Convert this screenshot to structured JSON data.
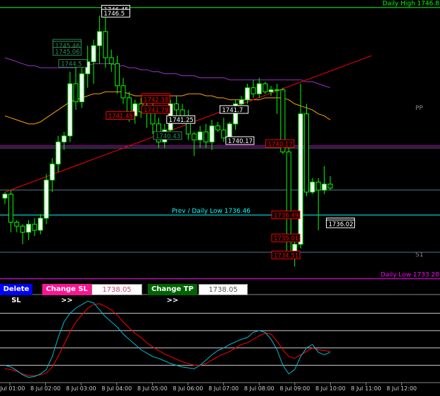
{
  "chart_data": {
    "type": "candlestick",
    "colors": {
      "background": "#000000",
      "bull": "#ffffff",
      "bear": "#000000",
      "wick": "#00ff00",
      "ma_fast": "#ffa500",
      "ma_slow": "#9932cc",
      "trend": "#ff0000",
      "osc_main": "#00bcd4",
      "osc_signal": "#ff0000",
      "level_daily_high": "#00ff00",
      "level_daily_low": "#ff00ff",
      "level_pivot": "#4d7d8c",
      "level_prev_low": "#00ffff"
    },
    "price_range": [
      1732.6,
      1747.0
    ],
    "candles": [
      {
        "o": 1737.3,
        "h": 1737.6,
        "l": 1737.0,
        "c": 1737.5
      },
      {
        "o": 1737.5,
        "h": 1737.7,
        "l": 1735.6,
        "c": 1736.1
      },
      {
        "o": 1736.1,
        "h": 1736.2,
        "l": 1735.6,
        "c": 1735.9
      },
      {
        "o": 1735.9,
        "h": 1736.0,
        "l": 1735.0,
        "c": 1735.6
      },
      {
        "o": 1735.6,
        "h": 1736.2,
        "l": 1735.2,
        "c": 1736.0
      },
      {
        "o": 1736.0,
        "h": 1736.3,
        "l": 1735.4,
        "c": 1735.7
      },
      {
        "o": 1735.7,
        "h": 1736.5,
        "l": 1735.5,
        "c": 1736.3
      },
      {
        "o": 1736.3,
        "h": 1738.5,
        "l": 1736.0,
        "c": 1738.2
      },
      {
        "o": 1738.2,
        "h": 1739.3,
        "l": 1737.6,
        "c": 1739.0
      },
      {
        "o": 1739.0,
        "h": 1740.4,
        "l": 1738.6,
        "c": 1740.1
      },
      {
        "o": 1740.1,
        "h": 1740.6,
        "l": 1739.7,
        "c": 1740.4
      },
      {
        "o": 1740.4,
        "h": 1743.6,
        "l": 1740.1,
        "c": 1743.0
      },
      {
        "o": 1743.0,
        "h": 1744.0,
        "l": 1741.7,
        "c": 1742.1
      },
      {
        "o": 1742.1,
        "h": 1743.8,
        "l": 1741.8,
        "c": 1743.5
      },
      {
        "o": 1743.5,
        "h": 1744.9,
        "l": 1742.8,
        "c": 1744.1
      },
      {
        "o": 1744.1,
        "h": 1745.2,
        "l": 1743.0,
        "c": 1744.9
      },
      {
        "o": 1744.9,
        "h": 1746.4,
        "l": 1744.0,
        "c": 1745.6
      },
      {
        "o": 1745.6,
        "h": 1746.5,
        "l": 1743.8,
        "c": 1744.3
      },
      {
        "o": 1744.3,
        "h": 1744.7,
        "l": 1743.6,
        "c": 1744.0
      },
      {
        "o": 1744.0,
        "h": 1744.4,
        "l": 1742.5,
        "c": 1742.9
      },
      {
        "o": 1742.9,
        "h": 1743.3,
        "l": 1742.0,
        "c": 1742.3
      },
      {
        "o": 1742.3,
        "h": 1742.6,
        "l": 1741.1,
        "c": 1741.4
      },
      {
        "o": 1741.4,
        "h": 1742.2,
        "l": 1741.0,
        "c": 1742.0
      },
      {
        "o": 1742.0,
        "h": 1742.3,
        "l": 1741.3,
        "c": 1741.6
      },
      {
        "o": 1741.6,
        "h": 1742.1,
        "l": 1740.8,
        "c": 1741.9
      },
      {
        "o": 1741.9,
        "h": 1742.1,
        "l": 1740.5,
        "c": 1741.0
      },
      {
        "o": 1741.0,
        "h": 1741.3,
        "l": 1739.8,
        "c": 1740.1
      },
      {
        "o": 1740.1,
        "h": 1741.0,
        "l": 1739.8,
        "c": 1740.7
      },
      {
        "o": 1740.7,
        "h": 1742.2,
        "l": 1740.5,
        "c": 1742.0
      },
      {
        "o": 1742.0,
        "h": 1742.4,
        "l": 1741.3,
        "c": 1741.7
      },
      {
        "o": 1741.7,
        "h": 1742.0,
        "l": 1741.0,
        "c": 1741.4
      },
      {
        "o": 1741.4,
        "h": 1741.7,
        "l": 1740.2,
        "c": 1740.5
      },
      {
        "o": 1740.5,
        "h": 1740.6,
        "l": 1739.4,
        "c": 1740.2
      },
      {
        "o": 1740.2,
        "h": 1740.9,
        "l": 1739.8,
        "c": 1740.6
      },
      {
        "o": 1740.6,
        "h": 1741.0,
        "l": 1739.8,
        "c": 1740.1
      },
      {
        "o": 1740.1,
        "h": 1741.2,
        "l": 1739.7,
        "c": 1740.9
      },
      {
        "o": 1740.9,
        "h": 1741.1,
        "l": 1740.6,
        "c": 1740.7
      },
      {
        "o": 1740.7,
        "h": 1741.3,
        "l": 1740.1,
        "c": 1740.3
      },
      {
        "o": 1740.3,
        "h": 1741.1,
        "l": 1740.2,
        "c": 1741.0
      },
      {
        "o": 1741.0,
        "h": 1742.2,
        "l": 1740.7,
        "c": 1742.0
      },
      {
        "o": 1742.0,
        "h": 1742.4,
        "l": 1741.6,
        "c": 1742.2
      },
      {
        "o": 1742.2,
        "h": 1743.0,
        "l": 1742.0,
        "c": 1742.8
      },
      {
        "o": 1742.8,
        "h": 1743.2,
        "l": 1742.3,
        "c": 1742.5
      },
      {
        "o": 1742.5,
        "h": 1743.3,
        "l": 1742.3,
        "c": 1743.0
      },
      {
        "o": 1743.0,
        "h": 1743.1,
        "l": 1742.5,
        "c": 1742.6
      },
      {
        "o": 1742.6,
        "h": 1742.9,
        "l": 1742.4,
        "c": 1742.7
      },
      {
        "o": 1742.7,
        "h": 1743.0,
        "l": 1741.5,
        "c": 1742.7
      },
      {
        "o": 1742.7,
        "h": 1742.8,
        "l": 1739.5,
        "c": 1739.6
      },
      {
        "o": 1739.6,
        "h": 1739.8,
        "l": 1734.4,
        "c": 1734.5
      },
      {
        "o": 1734.5,
        "h": 1735.5,
        "l": 1733.9,
        "c": 1735.0
      },
      {
        "o": 1735.0,
        "h": 1743.0,
        "l": 1734.8,
        "c": 1741.5
      },
      {
        "o": 1741.5,
        "h": 1742.0,
        "l": 1737.4,
        "c": 1737.6
      },
      {
        "o": 1737.6,
        "h": 1738.3,
        "l": 1737.5,
        "c": 1738.1
      },
      {
        "o": 1738.1,
        "h": 1738.3,
        "l": 1735.7,
        "c": 1737.7
      },
      {
        "o": 1737.7,
        "h": 1738.9,
        "l": 1737.5,
        "c": 1738.0
      },
      {
        "o": 1738.0,
        "h": 1738.4,
        "l": 1737.7,
        "c": 1737.8
      }
    ],
    "ma_fast": [
      1741.4,
      1741.3,
      1741.2,
      1741.1,
      1741.0,
      1741.0,
      1741.1,
      1741.3,
      1741.5,
      1741.7,
      1741.9,
      1742.1,
      1742.2,
      1742.3,
      1742.4,
      1742.5,
      1742.5,
      1742.6,
      1742.6,
      1742.6,
      1742.6,
      1742.5,
      1742.4,
      1742.4,
      1742.3,
      1742.3,
      1742.3,
      1742.3,
      1742.4,
      1742.4,
      1742.4,
      1742.5,
      1742.5,
      1742.5,
      1742.4,
      1742.4,
      1742.3,
      1742.3,
      1742.2,
      1742.2,
      1742.2,
      1742.2,
      1742.2,
      1742.2,
      1742.3,
      1742.3,
      1742.3,
      1742.3,
      1742.2,
      1742.0,
      1741.9,
      1741.8,
      1741.7,
      1741.5,
      1741.4,
      1741.2
    ],
    "ma_slow": [
      1744.3,
      1744.2,
      1744.1,
      1744.0,
      1743.9,
      1743.9,
      1743.8,
      1743.8,
      1743.8,
      1743.8,
      1743.8,
      1743.8,
      1743.8,
      1743.9,
      1743.9,
      1744.0,
      1744.0,
      1744.0,
      1744.0,
      1743.9,
      1743.9,
      1743.8,
      1743.8,
      1743.7,
      1743.7,
      1743.6,
      1743.6,
      1743.5,
      1743.5,
      1743.5,
      1743.4,
      1743.4,
      1743.4,
      1743.3,
      1743.3,
      1743.3,
      1743.3,
      1743.3,
      1743.2,
      1743.2,
      1743.2,
      1743.2,
      1743.2,
      1743.2,
      1743.2,
      1743.2,
      1743.2,
      1743.2,
      1743.2,
      1743.2,
      1743.2,
      1743.1,
      1743.1,
      1743.0,
      1742.9,
      1742.8
    ],
    "trend_line": {
      "from_candle": 0,
      "from_price": 1737.6,
      "to_candle": 62,
      "to_price": 1744.4
    },
    "levels": [
      {
        "name": "daily_high",
        "price": 1746.8,
        "label": "Daily High 1746.8",
        "color": "#00ff00",
        "label_pos": "right"
      },
      {
        "name": "pp",
        "price": 1739.9,
        "label": "",
        "color": "#ff00ff",
        "label_pos": "right"
      },
      {
        "name": "pp2",
        "price": 1739.8,
        "label": "",
        "color": "#4d7d8c",
        "label_pos": "right"
      },
      {
        "name": "pivot_mid",
        "price": 1737.7,
        "label": "",
        "color": "#4d7d8c",
        "label_pos": "right"
      },
      {
        "name": "prev_daily_low",
        "price": 1736.46,
        "label": "Prev / Daily Low 1736.46",
        "color": "#00ffff",
        "label_pos": "center"
      },
      {
        "name": "s1",
        "price": 1734.6,
        "label": "",
        "color": "#4d7d8c",
        "label_pos": "right"
      },
      {
        "name": "daily_low",
        "price": 1733.28,
        "label": "Daily Low 1733.28",
        "color": "#ff00ff",
        "label_pos": "right"
      }
    ],
    "side_labels": [
      {
        "text": "PP",
        "price": 1741.8
      },
      {
        "text": "S1",
        "price": 1734.5
      }
    ],
    "price_tags": [
      {
        "text": "1746.45",
        "price": 1746.7,
        "candle": 16,
        "style": "white",
        "offset": 0
      },
      {
        "text": "1746.5",
        "price": 1746.5,
        "candle": 16,
        "style": "white",
        "offset": 0
      },
      {
        "text": "1745.66",
        "price": 1745.0,
        "candle": 13,
        "style": "green",
        "offset": -1
      },
      {
        "text": "1745.46",
        "price": 1744.9,
        "candle": 13,
        "style": "green",
        "offset": -1
      },
      {
        "text": "1745.06",
        "price": 1744.6,
        "candle": 13,
        "style": "green",
        "offset": -1
      },
      {
        "text": "1744.5",
        "price": 1744.0,
        "candle": 14,
        "style": "green",
        "offset": -1
      },
      {
        "text": "1742.47",
        "price": 1742.3,
        "candle": 28,
        "style": "red",
        "offset": -1
      },
      {
        "text": "1742.38",
        "price": 1742.2,
        "candle": 28,
        "style": "red",
        "offset": -1
      },
      {
        "text": "1741.79",
        "price": 1741.7,
        "candle": 28,
        "style": "red",
        "offset": -1
      },
      {
        "text": "1741.45",
        "price": 1741.4,
        "candle": 22,
        "style": "red",
        "offset": -1
      },
      {
        "text": "1741.7",
        "price": 1741.7,
        "candle": 36,
        "style": "white",
        "offset": 0
      },
      {
        "text": "1741.25",
        "price": 1741.2,
        "candle": 27,
        "style": "white",
        "offset": 0
      },
      {
        "text": "1740.43",
        "price": 1740.4,
        "candle": 30,
        "style": "green",
        "offset": -1
      },
      {
        "text": "1740.17",
        "price": 1740.15,
        "candle": 37,
        "style": "white",
        "offset": 0
      },
      {
        "text": "1740.17",
        "price": 1740.0,
        "candle": 49,
        "style": "red",
        "offset": -1
      },
      {
        "text": "1736.49",
        "price": 1736.45,
        "candle": 50,
        "style": "red",
        "offset": -1
      },
      {
        "text": "1735.01",
        "price": 1735.3,
        "candle": 50,
        "style": "red",
        "offset": -1
      },
      {
        "text": "1734.51",
        "price": 1734.45,
        "candle": 50,
        "style": "red",
        "offset": -1
      },
      {
        "text": "1736.12",
        "price": 1736.1,
        "candle": 54,
        "style": "white",
        "offset": 0
      },
      {
        "text": "1736.02",
        "price": 1736.0,
        "candle": 54,
        "style": "white",
        "offset": 0
      }
    ],
    "buttons": {
      "delete_sl": "Delete SL",
      "change_sl": "Change SL >>",
      "sl_value": "1738.05",
      "change_tp": "Change TP >>",
      "tp_value": "1738.05"
    },
    "oscillator": {
      "levels": [
        80,
        60,
        40,
        20
      ],
      "range": [
        0,
        100
      ],
      "main": [
        20,
        18,
        14,
        9,
        6,
        7,
        10,
        15,
        30,
        52,
        70,
        80,
        86,
        90,
        94,
        92,
        84,
        76,
        70,
        64,
        56,
        50,
        44,
        38,
        34,
        30,
        28,
        25,
        22,
        20,
        18,
        17,
        16,
        20,
        26,
        32,
        37,
        40,
        44,
        47,
        50,
        52,
        58,
        60,
        58,
        50,
        38,
        20,
        10,
        15,
        30,
        40,
        44,
        35,
        32,
        35
      ],
      "signal": [
        16,
        15,
        13,
        10,
        8,
        8,
        9,
        11,
        18,
        30,
        44,
        58,
        70,
        78,
        86,
        90,
        91,
        88,
        84,
        78,
        70,
        63,
        57,
        52,
        46,
        41,
        37,
        33,
        30,
        27,
        24,
        22,
        20,
        20,
        22,
        26,
        30,
        33,
        36,
        40,
        44,
        46,
        50,
        54,
        57,
        56,
        48,
        38,
        30,
        28,
        32,
        36,
        40,
        38,
        37,
        36
      ]
    },
    "x_ticks": [
      "8 Jul 01:00",
      "8 Jul 02:00",
      "8 Jul 03:00",
      "8 Jul 04:00",
      "8 Jul 05:00",
      "8 Jul 06:00",
      "8 Jul 07:00",
      "8 Jul 08:00",
      "8 Jul 09:00",
      "8 Jul 10:00",
      "8 Jul 11:00",
      "8 Jul 12:00"
    ]
  }
}
